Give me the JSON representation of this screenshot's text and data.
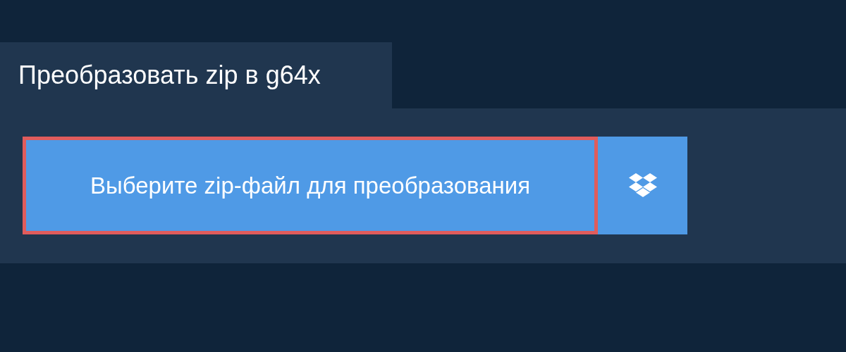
{
  "tab": {
    "title": "Преобразовать zip в g64x"
  },
  "buttons": [
    {
      "kind": "file",
      "label": "Выберите zip-файл для преобразования",
      "focused": true
    },
    {
      "kind": "cloud",
      "focused": false
    }
  ]
}
